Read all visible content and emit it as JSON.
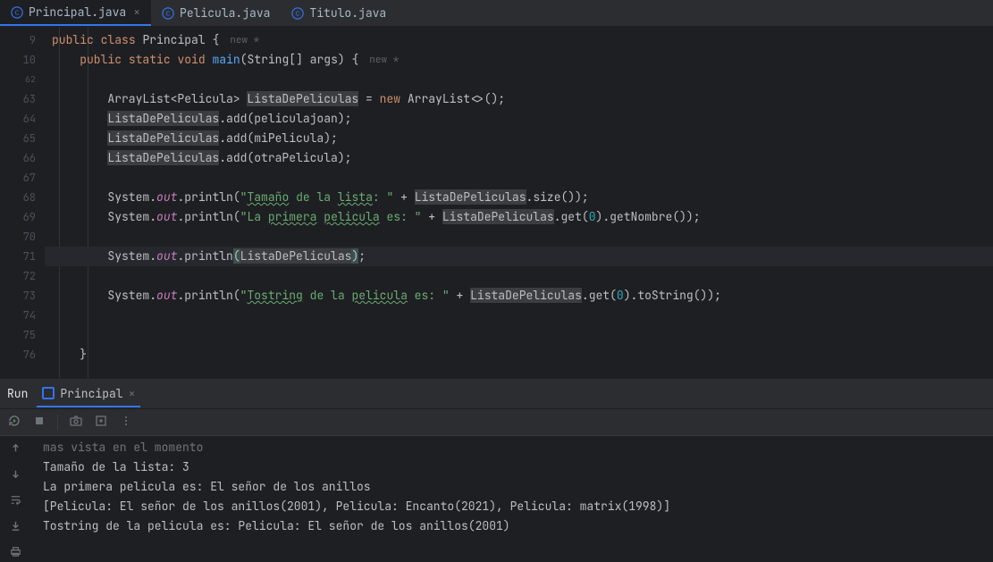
{
  "tabs": [
    {
      "label": "Principal.java",
      "active": true,
      "closeable": true
    },
    {
      "label": "Pelicula.java",
      "active": false,
      "closeable": false
    },
    {
      "label": "Titulo.java",
      "active": false,
      "closeable": false
    }
  ],
  "editor": {
    "lineNumbers": [
      "9",
      "10",
      "62",
      "63",
      "64",
      "65",
      "66",
      "67",
      "68",
      "69",
      "70",
      "71",
      "72",
      "73",
      "74",
      "75",
      "76"
    ],
    "activeLine": 71,
    "breadcrumbs": {
      "line9": "new *",
      "line10": "new *"
    },
    "code": {
      "kw_public": "public",
      "kw_class": "class",
      "kw_static": "static",
      "kw_void": "void",
      "kw_new": "new",
      "cls_principal": "Principal",
      "fn_main": "main",
      "main_params": "(String[] args)",
      "brace_open": " {",
      "arraylist": "ArrayList",
      "pelicula_gen": "<Pelicula> ",
      "var_lista": "ListaDePeliculas",
      "assign_new": " ArrayList<>();",
      "add_open": ".add(",
      "v_peliculajoan": "peliculajoan",
      "v_mipelicula": "miPelicula",
      "v_otrapelicula": "otraPelicula",
      "close_stmt": ");",
      "system": "System",
      "dot": ".",
      "out": "out",
      "println": ".println(",
      "str_tamano1": "\"",
      "str_tamano_w": "Tamaño",
      "str_tamano2": " de la ",
      "str_tamano_w2": "lista",
      "str_tamano3": ": \"",
      "plus": " + ",
      "size_call": ".size());",
      "str_primera1": "\"La ",
      "str_primera_w": "primera",
      "str_primera2": " ",
      "str_primera_w2": "pelicula",
      "str_primera3": " es: \"",
      "get0_nombre": ".get(",
      "num0": "0",
      "get_close_nombre": ").getNombre());",
      "println_lista_only": ");",
      "str_tostr1": "\"",
      "str_tostr_w": "Tostring",
      "str_tostr2": " de la ",
      "str_tostr_w2": "pelicula",
      "str_tostr3": " es: \"",
      "get_close_tostr": ").toString());",
      "brace_close": "}"
    }
  },
  "run": {
    "panelTitle": "Run",
    "tabLabel": "Principal",
    "output": [
      "mas vista en el momento",
      "Tamaño de la lista: 3",
      "La primera pelicula es: El señor de los anillos",
      "[Pelicula: El señor de los anillos(2001), Pelicula: Encanto(2021), Pelicula: matrix(1998)]",
      "Tostring de la pelicula es: Pelicula: El señor de los anillos(2001)"
    ]
  },
  "colors": {
    "accent": "#3574f0"
  }
}
